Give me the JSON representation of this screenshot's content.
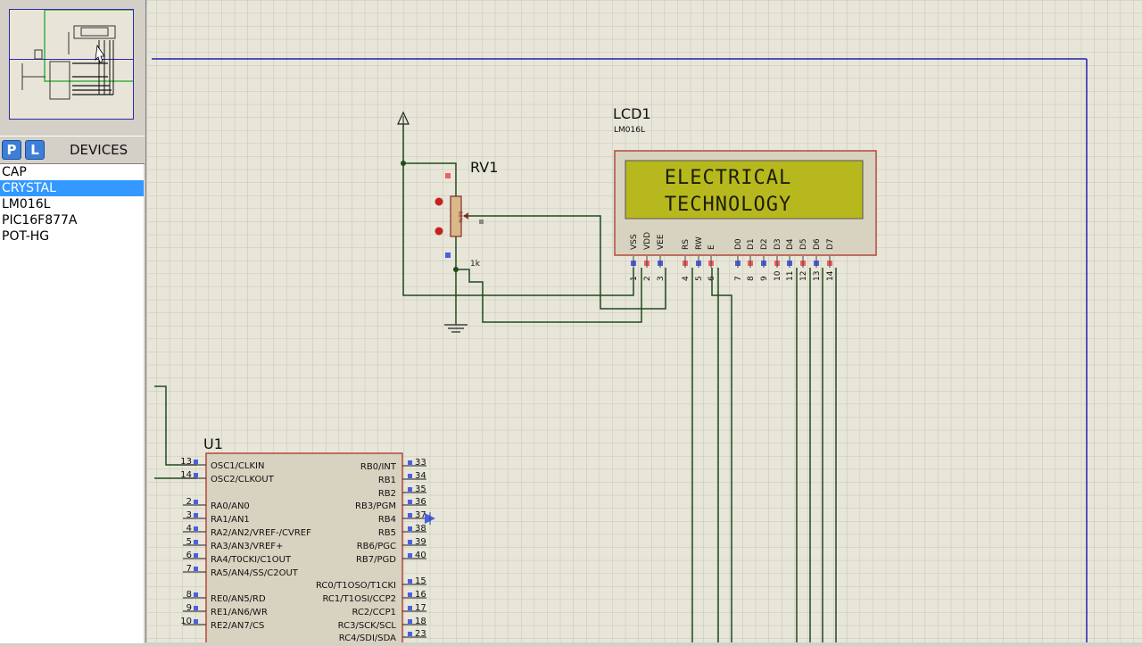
{
  "devices_panel": {
    "p_button": "P",
    "l_button": "L",
    "title": "DEVICES",
    "items": [
      "CAP",
      "CRYSTAL",
      "LM016L",
      "PIC16F877A",
      "POT-HG"
    ],
    "selected_index": 1
  },
  "schematic": {
    "lcd": {
      "ref": "LCD1",
      "part": "LM016L",
      "line1": "ELECTRICAL",
      "line2": "TECHNOLOGY",
      "pin_names": [
        "VSS",
        "VDD",
        "VEE",
        "RS",
        "RW",
        "E",
        "D0",
        "D1",
        "D2",
        "D3",
        "D4",
        "D5",
        "D6",
        "D7"
      ],
      "pin_numbers": [
        "1",
        "2",
        "3",
        "4",
        "5",
        "6",
        "7",
        "8",
        "9",
        "10",
        "11",
        "12",
        "13",
        "14"
      ]
    },
    "pot": {
      "ref": "RV1",
      "value": "1k",
      "body_label": "98%"
    },
    "mcu": {
      "ref": "U1",
      "left_pins": [
        {
          "num": "13",
          "name": "OSC1/CLKIN"
        },
        {
          "num": "14",
          "name": "OSC2/CLKOUT"
        },
        {
          "num": "2",
          "name": "RA0/AN0"
        },
        {
          "num": "3",
          "name": "RA1/AN1"
        },
        {
          "num": "4",
          "name": "RA2/AN2/VREF-/CVREF"
        },
        {
          "num": "5",
          "name": "RA3/AN3/VREF+"
        },
        {
          "num": "6",
          "name": "RA4/T0CKI/C1OUT"
        },
        {
          "num": "7",
          "name": "RA5/AN4/SS/C2OUT"
        },
        {
          "num": "8",
          "name": "RE0/AN5/RD"
        },
        {
          "num": "9",
          "name": "RE1/AN6/WR"
        },
        {
          "num": "10",
          "name": "RE2/AN7/CS"
        }
      ],
      "right_pins": [
        {
          "num": "33",
          "name": "RB0/INT"
        },
        {
          "num": "34",
          "name": "RB1"
        },
        {
          "num": "35",
          "name": "RB2"
        },
        {
          "num": "36",
          "name": "RB3/PGM"
        },
        {
          "num": "37",
          "name": "RB4"
        },
        {
          "num": "38",
          "name": "RB5"
        },
        {
          "num": "39",
          "name": "RB6/PGC"
        },
        {
          "num": "40",
          "name": "RB7/PGD"
        },
        {
          "num": "15",
          "name": "RC0/T1OSO/T1CKI"
        },
        {
          "num": "16",
          "name": "RC1/T1OSI/CCP2"
        },
        {
          "num": "17",
          "name": "RC2/CCP1"
        },
        {
          "num": "18",
          "name": "RC3/SCK/SCL"
        },
        {
          "num": "23",
          "name": "RC4/SDI/SDA"
        }
      ]
    }
  }
}
